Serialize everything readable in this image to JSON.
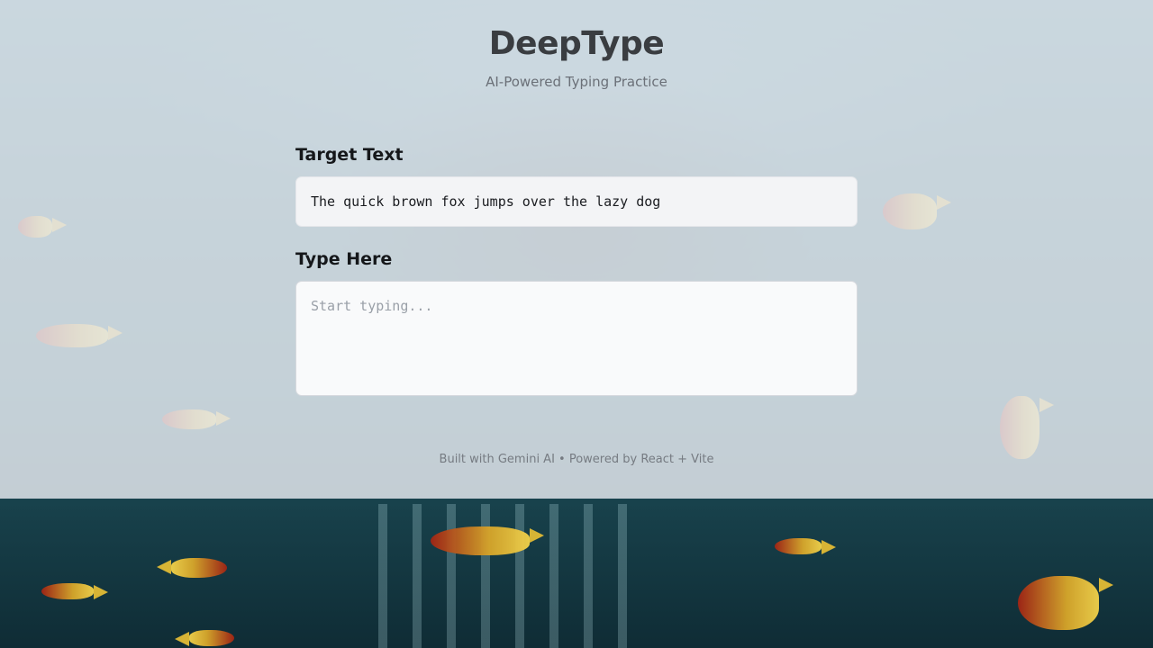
{
  "header": {
    "title": "DeepType",
    "subtitle": "AI-Powered Typing Practice"
  },
  "target": {
    "label": "Target Text",
    "text": "The quick brown fox jumps over the lazy dog"
  },
  "input": {
    "label": "Type Here",
    "value": "",
    "placeholder": "Start typing..."
  },
  "footer": {
    "text": "Built with Gemini AI • Powered by React + Vite"
  },
  "colors": {
    "overlay": "#e5e8ee",
    "title": "#3a3d41",
    "label": "#15171a",
    "water": "#1e5863"
  }
}
